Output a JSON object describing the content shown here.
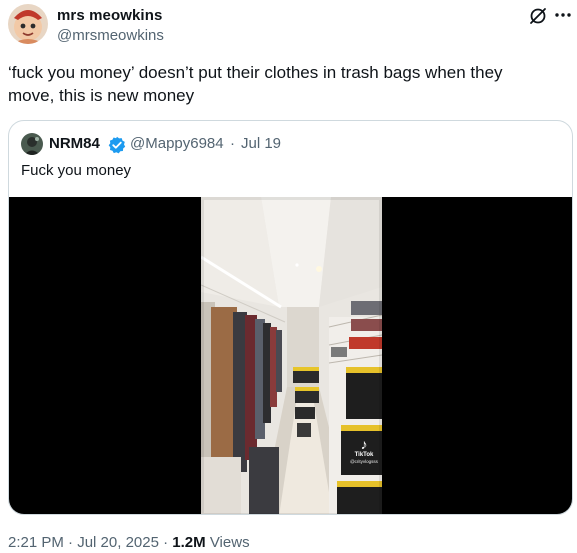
{
  "author": {
    "display_name": "mrs meowkins",
    "handle": "@mrsmeowkins",
    "avatar": "profile-avatar"
  },
  "actions": {
    "grok_icon": "grok-icon",
    "more_icon": "more-icon"
  },
  "tweet": {
    "text": "‘fuck you money’ doesn’t put their clothes in trash bags when they move,  this is new money"
  },
  "quote": {
    "display_name": "NRM84",
    "verified": "verified-badge-icon",
    "handle": "@Mappy6984",
    "separator": "·",
    "date": "Jul 19",
    "text": "Fuck you money",
    "media": {
      "type": "video",
      "watermark_logo": "♪",
      "watermark_label": "TikTok",
      "watermark_user": "@crityvlogsss"
    }
  },
  "meta": {
    "time": "2:21 PM",
    "dot1": " · ",
    "date": "Jul 20, 2025",
    "dot2": " · ",
    "views_count": "1.2M",
    "views_label": " Views"
  },
  "colors": {
    "text_primary": "#0f1419",
    "text_secondary": "#536471",
    "border": "#cfd9de",
    "verified_blue": "#1d9bf0"
  }
}
